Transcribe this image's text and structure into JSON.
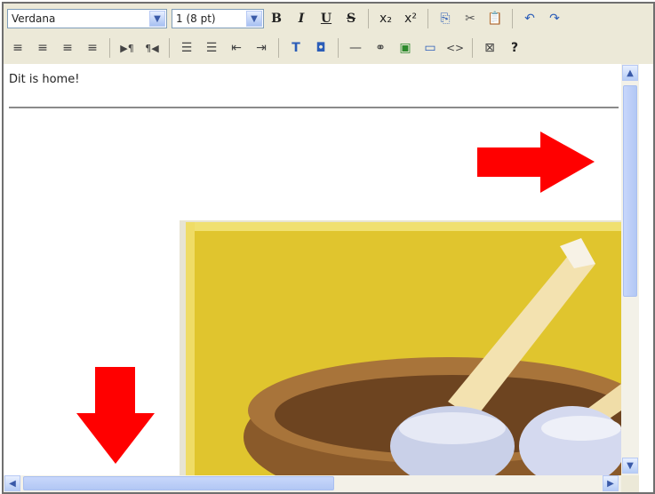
{
  "toolbar": {
    "font_select": {
      "value": "Verdana"
    },
    "size_select": {
      "value": "1 (8 pt)"
    },
    "buttons": {
      "bold": "B",
      "italic": "I",
      "underline": "U",
      "strike": "S",
      "subscript": "x₂",
      "superscript": "x²",
      "copy": "⎘",
      "cut": "✂",
      "paste": "📋",
      "undo": "↶",
      "redo": "↷",
      "align_left": "≡",
      "align_center": "≡",
      "align_right": "≡",
      "justify": "≡",
      "ltr": "▶¶",
      "rtl": "¶◀",
      "ordered_list": "☰",
      "unordered_list": "☰",
      "outdent": "⇤",
      "indent": "⇥",
      "text_color": "T",
      "highlight": "◘",
      "horizontal_rule": "—",
      "link": "⚭",
      "image": "▣",
      "table": "▭",
      "source": "<>",
      "clear": "⊠",
      "help": "?"
    }
  },
  "content": {
    "text": "Dit is home!"
  },
  "colors": {
    "toolbar_bg": "#ece9d8",
    "arrow": "#ff0000",
    "scroll": "#b2c7f4",
    "photo_wall": "#e0c52e"
  },
  "scroll": {
    "up": "▲",
    "down": "▼",
    "left": "◀",
    "right": "▶"
  }
}
